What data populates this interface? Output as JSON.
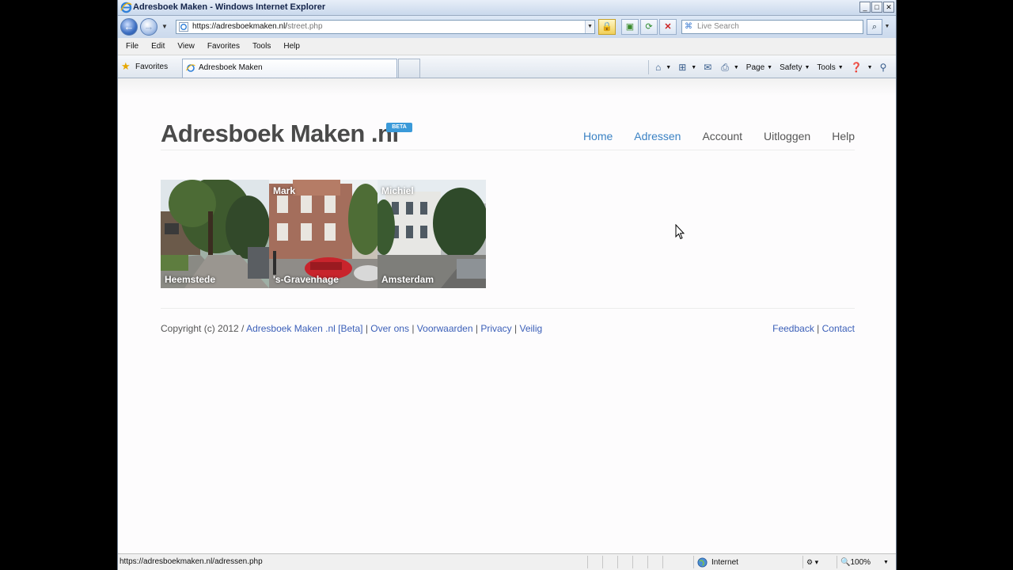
{
  "window": {
    "title": "Adresboek Maken - Windows Internet Explorer",
    "controls": [
      "_",
      "□",
      "✕"
    ]
  },
  "address_bar": {
    "url_host": "https://adresboekmaken.nl/",
    "url_path": "street.php",
    "search_placeholder": "Live Search"
  },
  "menu": {
    "items": [
      "File",
      "Edit",
      "View",
      "Favorites",
      "Tools",
      "Help"
    ]
  },
  "favorites_bar": {
    "favorites_label": "Favorites",
    "tab_title": "Adresboek Maken",
    "commands": [
      "Page",
      "Safety",
      "Tools"
    ]
  },
  "site": {
    "title": "Adresboek Maken .nl",
    "badge": "BETA",
    "nav": [
      {
        "label": "Home",
        "active": true
      },
      {
        "label": "Adressen",
        "active": true
      },
      {
        "label": "Account",
        "active": false
      },
      {
        "label": "Uitloggen",
        "active": false
      },
      {
        "label": "Help",
        "active": false
      }
    ],
    "tiles": [
      {
        "name": "",
        "city": "Heemstede"
      },
      {
        "name": "Mark",
        "city": "'s-Gravenhage"
      },
      {
        "name": "Michiel",
        "city": "Amsterdam"
      }
    ],
    "footer": {
      "copyright": "Copyright (c) 2012 / ",
      "brand_link": "Adresboek Maken .nl [Beta]",
      "links": [
        "Over ons",
        "Voorwaarden",
        "Privacy",
        "Veilig"
      ],
      "right_links": [
        "Feedback",
        "Contact"
      ]
    }
  },
  "status_bar": {
    "url": "https://adresboekmaken.nl/adressen.php",
    "zone": "Internet",
    "zoom": "100%"
  },
  "colors": {
    "link": "#3b5fb8",
    "nav_active": "#3b82c4",
    "badge": "#3a9ad9",
    "title": "#4a4a4a"
  }
}
